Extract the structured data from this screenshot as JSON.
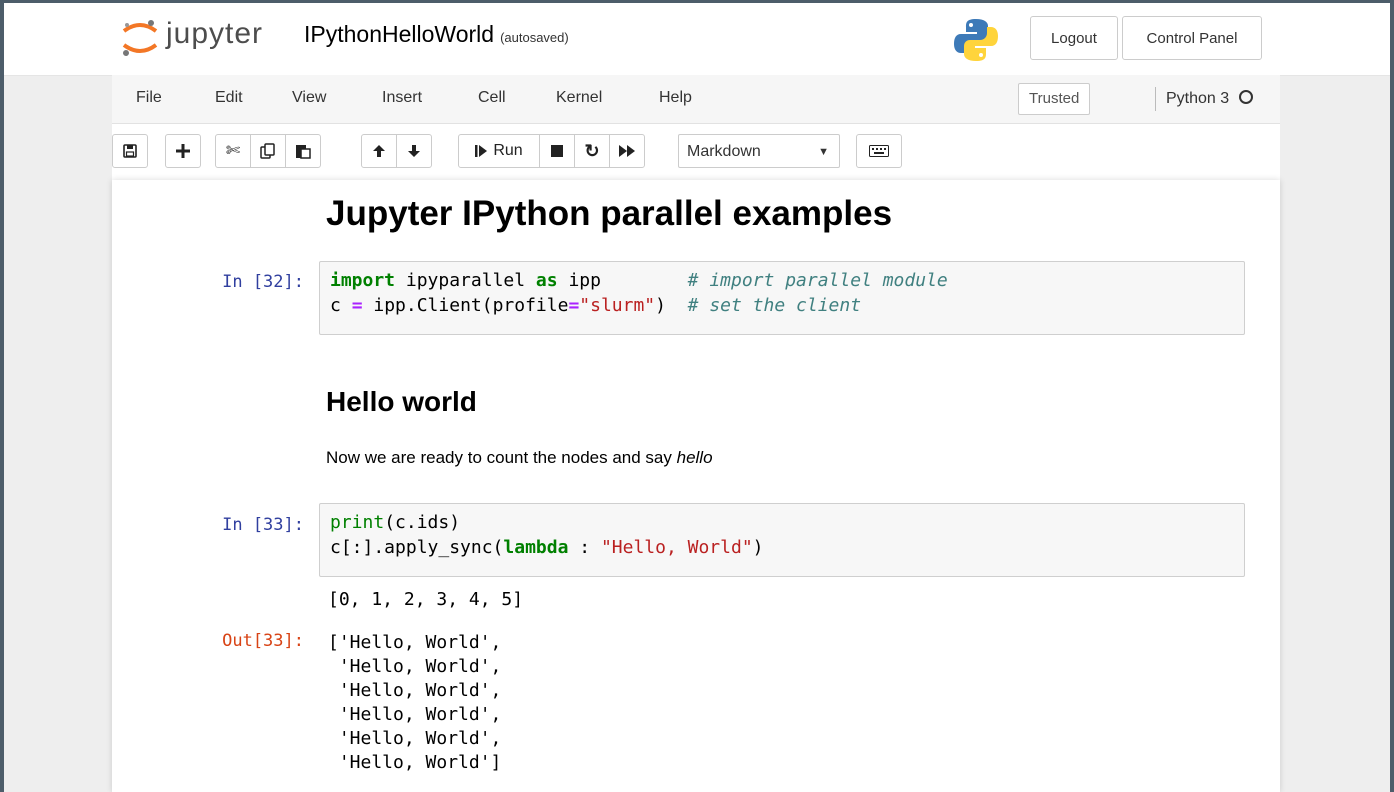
{
  "header": {
    "logo_text": "jupyter",
    "notebook_name": "IPythonHelloWorld",
    "autosave_status": "(autosaved)",
    "logout_label": "Logout",
    "control_panel_label": "Control Panel"
  },
  "menu": {
    "items": [
      "File",
      "Edit",
      "View",
      "Insert",
      "Cell",
      "Kernel",
      "Help"
    ],
    "trusted_label": "Trusted",
    "kernel_name": "Python 3"
  },
  "toolbar": {
    "run_label": "Run",
    "cell_type": "Markdown"
  },
  "notebook": {
    "title": "Jupyter IPython parallel examples",
    "cell1": {
      "prompt": "In [32]:",
      "line1": {
        "kw": "import",
        "mod": " ipyparallel ",
        "as": "as",
        "alias": " ipp        ",
        "comment": "# import parallel module"
      },
      "line2": {
        "a": "c ",
        "eq": "=",
        "b": " ipp.Client(profile",
        "eq2": "=",
        "str": "\"slurm\"",
        "c": ")  ",
        "comment": "# set the client"
      }
    },
    "section_heading": "Hello world",
    "paragraph_text": "Now we are ready to count the nodes and say ",
    "paragraph_em": "hello",
    "cell2": {
      "prompt": "In [33]:",
      "line1": {
        "fn": "print",
        "rest": "(c.ids)"
      },
      "line2": {
        "a": "c[:].apply_sync(",
        "kw": "lambda",
        "b": " : ",
        "str": "\"Hello, World\"",
        "c": ")"
      },
      "stdout": "[0, 1, 2, 3, 4, 5]",
      "out_prompt": "Out[33]:",
      "result": "['Hello, World',\n 'Hello, World',\n 'Hello, World',\n 'Hello, World',\n 'Hello, World',\n 'Hello, World']"
    }
  }
}
